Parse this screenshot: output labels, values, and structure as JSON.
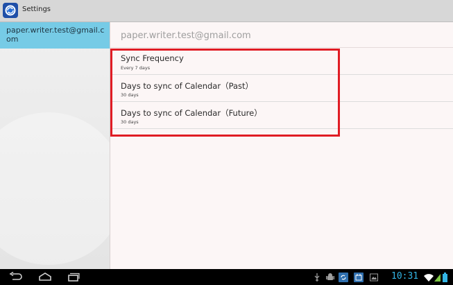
{
  "window": {
    "title": "Settings",
    "app_icon": "sync-settings-icon"
  },
  "sidebar": {
    "account": "paper.writer.test@gmail.com"
  },
  "main": {
    "header": "paper.writer.test@gmail.com",
    "preferences": [
      {
        "title": "Sync Frequency",
        "summary": "Every 7 days"
      },
      {
        "title": "Days to sync of Calendar（Past）",
        "summary": "30 days"
      },
      {
        "title": "Days to sync of Calendar（Future）",
        "summary": "30 days"
      }
    ]
  },
  "navbar": {
    "buttons": [
      "back-icon",
      "home-icon",
      "recent-apps-icon"
    ],
    "status_icons": [
      "usb-icon",
      "android-debug-icon",
      "sync-notification-icon",
      "calendar-notification-icon",
      "image-notification-icon",
      "wifi-icon",
      "signal-icon",
      "battery-icon"
    ],
    "clock": "10:31"
  },
  "colors": {
    "sidebar_selected": "#76cbe6",
    "clock": "#33b5e5",
    "highlight": "#e01c24"
  }
}
